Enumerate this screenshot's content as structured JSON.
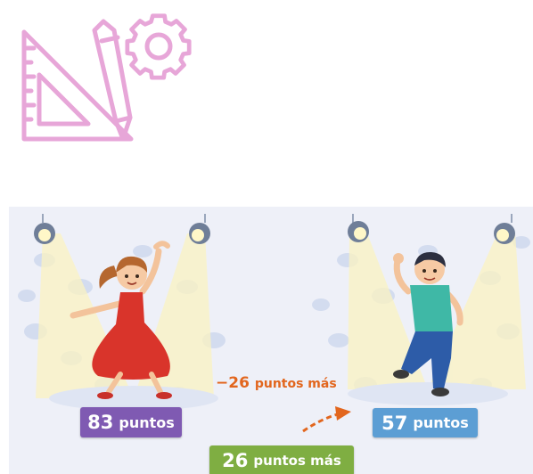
{
  "top_icon": {
    "name": "engineering-tools-icon",
    "color": "#e7a6d8"
  },
  "scene": {
    "girl_score": {
      "value": "83",
      "unit": "puntos",
      "color": "#7f5ab2"
    },
    "boy_score": {
      "value": "57",
      "unit": "puntos",
      "color": "#5c9ed4"
    },
    "difference_label": {
      "value": "−26",
      "unit": "puntos más",
      "color": "#e2661e"
    },
    "difference_box": {
      "value": "26",
      "unit": "puntos más",
      "color": "#7fae42"
    }
  }
}
